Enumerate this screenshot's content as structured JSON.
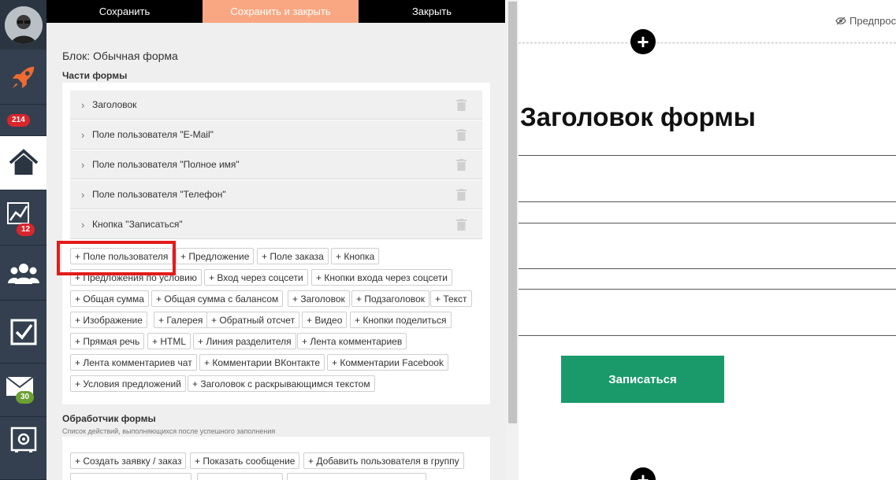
{
  "toolbar": {
    "save": "Сохранить",
    "save_close": "Сохранить и закрыть",
    "close": "Закрыть"
  },
  "nav": {
    "items": [
      {
        "icon": "rocket-icon",
        "badge": "214",
        "badge_color": "#d9262c"
      },
      {
        "icon": "home-icon",
        "active": true
      },
      {
        "icon": "chart-icon",
        "badge": "12",
        "badge_color": "#d9262c"
      },
      {
        "icon": "users-icon"
      },
      {
        "icon": "checkbox-icon"
      },
      {
        "icon": "mail-icon",
        "badge": "30",
        "badge_color": "#6ba032"
      },
      {
        "icon": "safe-gear-icon"
      }
    ]
  },
  "panel": {
    "block_title": "Блок: Обычная форма",
    "parts_title": "Части формы",
    "parts": [
      "Заголовок",
      "Поле пользователя \"E-Mail\"",
      "Поле пользователя \"Полное имя\"",
      "Поле пользователя \"Телефон\"",
      "Кнопка \"Записаться\""
    ],
    "add_chips": [
      [
        "+ Поле пользователя",
        "+ Предложение",
        "+ Поле заказа",
        "+ Кнопка"
      ],
      [
        "+ Предложения по условию",
        "+ Вход через соцсети",
        "+ Кнопки входа через соцсети"
      ],
      [
        "+ Общая сумма",
        "+ Общая сумма с балансом",
        "+ Заголовок",
        "+ Подзаголовок",
        "+ Текст"
      ],
      [
        "+ Изображение",
        "+ Галерея",
        "+ Обратный отсчет",
        "+ Видео",
        "+ Кнопки поделиться"
      ],
      [
        "+ Прямая речь",
        "+ HTML",
        "+ Линия разделителя",
        "+ Лента комментариев"
      ],
      [
        "+ Лента комментариев чат",
        "+ Комментарии ВКонтакте",
        "+ Комментарии Facebook"
      ],
      [
        "+ Условия предложений",
        "+ Заголовок с раскрывающимся текстом"
      ]
    ],
    "handler_title": "Обработчик формы",
    "handler_sub": "Список действий, выполняющихся после успешного заполнения",
    "handler_chips": [
      "+ Создать заявку / заказ",
      "+ Показать сообщение",
      "+ Добавить пользователя в группу"
    ]
  },
  "preview": {
    "link": "Предпросмотр",
    "form_title": "Заголовок формы",
    "submit": "Записаться",
    "add_symbol": "+"
  },
  "colors": {
    "nav_bg": "#2b3542",
    "accent_save_close": "#f9a782",
    "highlight": "#e31b1b",
    "submit_bg": "#1a9a6a"
  }
}
